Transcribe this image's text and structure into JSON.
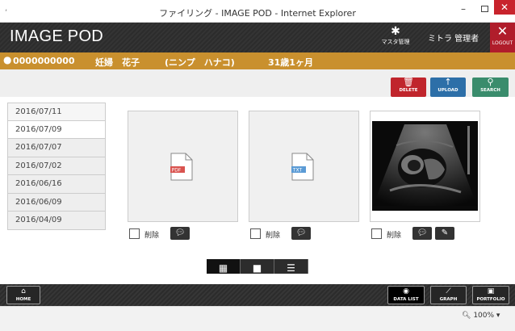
{
  "window": {
    "title": "ファイリング - IMAGE POD - Internet Explorer",
    "min": "–",
    "close": "✕"
  },
  "header": {
    "app_title": "IMAGE POD",
    "master_label": "マスタ管理",
    "user_name": "ミトラ 管理者",
    "logout_label": "LOGOUT"
  },
  "patient": {
    "id": "0000000000",
    "name": "妊婦　花子",
    "kana": "(ニンプ　ハナコ)",
    "age": "31歳1ヶ月"
  },
  "toolbar": {
    "delete_label": "DELETE",
    "upload_label": "UPLOAD",
    "search_label": "SEARCH"
  },
  "dates": [
    "2016/07/11",
    "2016/07/09",
    "2016/07/07",
    "2016/07/02",
    "2016/06/16",
    "2016/06/09",
    "2016/04/09"
  ],
  "selected_date": "2016/07/09",
  "files": [
    {
      "type_label": "PDF",
      "badge_color": "#d9534f",
      "delete_label": "削除",
      "icons": [
        "comment-icon"
      ]
    },
    {
      "type_label": "TXT",
      "badge_color": "#5b9bd5",
      "delete_label": "削除",
      "icons": [
        "comment-icon"
      ]
    },
    {
      "type_label": "ultrasound image",
      "delete_label": "削除",
      "icons": [
        "comment-icon",
        "pencil-icon"
      ]
    }
  ],
  "views": [
    "grid-view-icon",
    "single-view-icon",
    "list-view-icon"
  ],
  "footer": {
    "home_label": "HOME",
    "datalist_label": "DATA LIST",
    "graph_label": "GRAPH",
    "portfolio_label": "PORTFOLIO"
  },
  "status": {
    "zoom": "100%"
  },
  "colors": {
    "accent_orange": "#c9902e",
    "delete_red": "#c0252c",
    "upload_blue": "#2d6fa8",
    "search_green": "#3a8c6c"
  }
}
